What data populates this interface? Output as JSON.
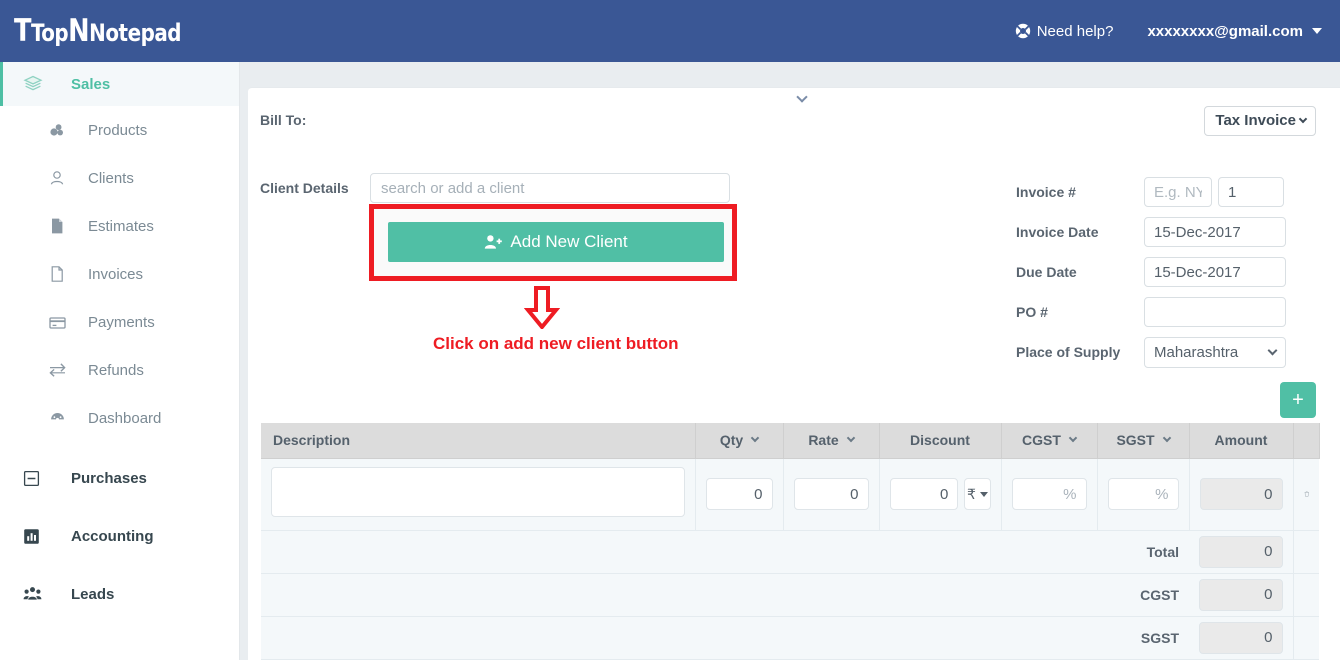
{
  "header": {
    "logo_top": "Top",
    "logo_note": "Notepad",
    "help_label": "Need help?",
    "help_icon": "lifering-icon",
    "user_email": "xxxxxxxx@gmail.com",
    "brand_color": "#3a5795"
  },
  "sidebar": {
    "groups": [
      {
        "label": "Sales",
        "icon": "layers-icon",
        "active": true
      },
      {
        "label": "Purchases",
        "icon": "minus-square-icon",
        "active": false
      },
      {
        "label": "Accounting",
        "icon": "bar-chart-icon",
        "active": false
      },
      {
        "label": "Leads",
        "icon": "users-group-icon",
        "active": false
      }
    ],
    "sales_items": [
      {
        "label": "Products",
        "icon": "cubes-icon"
      },
      {
        "label": "Clients",
        "icon": "user-outline-icon"
      },
      {
        "label": "Estimates",
        "icon": "file-filled-icon"
      },
      {
        "label": "Invoices",
        "icon": "file-outline-icon"
      },
      {
        "label": "Payments",
        "icon": "credit-card-icon"
      },
      {
        "label": "Refunds",
        "icon": "exchange-icon"
      },
      {
        "label": "Dashboard",
        "icon": "dashboard-icon"
      }
    ],
    "active_color": "#4ebfa4"
  },
  "main": {
    "collapse_icon": "chevron-down-icon",
    "bill_to_label": "Bill To:",
    "doc_type": "Tax Invoice",
    "client_details_label": "Client Details",
    "client_search_placeholder": "search or add a client",
    "client_search_value": "",
    "add_new_client_label": "Add New Client",
    "add_new_client_icon": "user-plus-icon",
    "add_row_label": "+",
    "accent_color": "#50bfa5"
  },
  "annotation": {
    "text": "Click on add new client button",
    "color": "#ee1c23",
    "arrow_icon": "arrow-down-icon"
  },
  "form": {
    "fields": [
      {
        "label": "Invoice #",
        "placeholder": "E.g. NYC",
        "value": "",
        "value2": "1"
      },
      {
        "label": "Invoice Date",
        "placeholder": "",
        "value": "15-Dec-2017"
      },
      {
        "label": "Due Date",
        "placeholder": "",
        "value": "15-Dec-2017"
      },
      {
        "label": "PO #",
        "placeholder": "",
        "value": ""
      },
      {
        "label": "Place of Supply",
        "placeholder": "",
        "value": "Maharashtra",
        "type": "select"
      }
    ]
  },
  "table": {
    "columns": [
      {
        "label": "Description",
        "sortable": false
      },
      {
        "label": "Qty",
        "sortable": true
      },
      {
        "label": "Rate",
        "sortable": true
      },
      {
        "label": "Discount",
        "sortable": false
      },
      {
        "label": "CGST",
        "sortable": true
      },
      {
        "label": "SGST",
        "sortable": true
      },
      {
        "label": "Amount",
        "sortable": false
      }
    ],
    "row": {
      "description": "",
      "qty": "0",
      "rate": "0",
      "discount": "0",
      "discount_currency": "₹",
      "cgst": "",
      "cgst_placeholder": "%",
      "sgst": "",
      "sgst_placeholder": "%",
      "amount": "0",
      "delete_icon": "trash-icon"
    },
    "totals": [
      {
        "label": "Total",
        "value": "0"
      },
      {
        "label": "CGST",
        "value": "0"
      },
      {
        "label": "SGST",
        "value": "0"
      }
    ]
  }
}
